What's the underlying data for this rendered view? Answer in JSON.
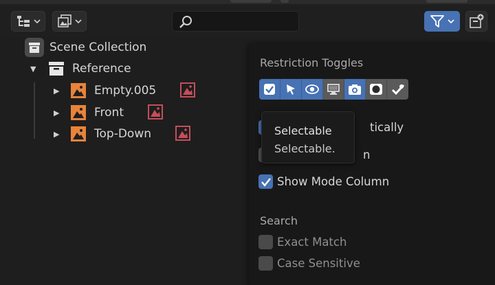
{
  "header": {
    "display_mode_icon": "outliner-tree-icon",
    "filter_icon": "funnel-icon",
    "search": {
      "value": "",
      "placeholder": ""
    }
  },
  "tree": {
    "root": {
      "label": "Scene Collection",
      "icon": "scene-collection-icon"
    },
    "collection": {
      "label": "Reference",
      "icon": "collection-icon"
    },
    "items": [
      {
        "label": "Empty.005",
        "icon": "image-empty-icon",
        "data_icon": "image-data-icon"
      },
      {
        "label": "Front",
        "icon": "image-empty-icon",
        "data_icon": "image-data-icon"
      },
      {
        "label": "Top-Down",
        "icon": "image-empty-icon",
        "data_icon": "image-data-icon"
      }
    ]
  },
  "popup": {
    "restriction_title": "Restriction Toggles",
    "toggles": [
      {
        "name": "exclude-checkbox",
        "active": true
      },
      {
        "name": "selectable",
        "active": true
      },
      {
        "name": "hide-in-viewport",
        "active": true
      },
      {
        "name": "disable-in-viewports",
        "active": false
      },
      {
        "name": "disable-in-renders",
        "active": true
      },
      {
        "name": "holdout",
        "active": false
      },
      {
        "name": "indirect-only",
        "active": false
      }
    ],
    "options": [
      {
        "label": "tically",
        "checked": true
      },
      {
        "label": "n",
        "checked": false
      },
      {
        "label": "Show Mode Column",
        "checked": true
      }
    ],
    "search_title": "Search",
    "search_options": [
      {
        "label": "Exact Match",
        "checked": false
      },
      {
        "label": "Case Sensitive",
        "checked": false
      }
    ]
  },
  "tooltip": {
    "title": "Selectable",
    "description": "Selectable."
  },
  "colors": {
    "accent": "#4772b3",
    "image_icon": "#e8833a",
    "image_data_icon": "#c64d5b",
    "background": "#1e1e1e",
    "popup": "#181818"
  }
}
